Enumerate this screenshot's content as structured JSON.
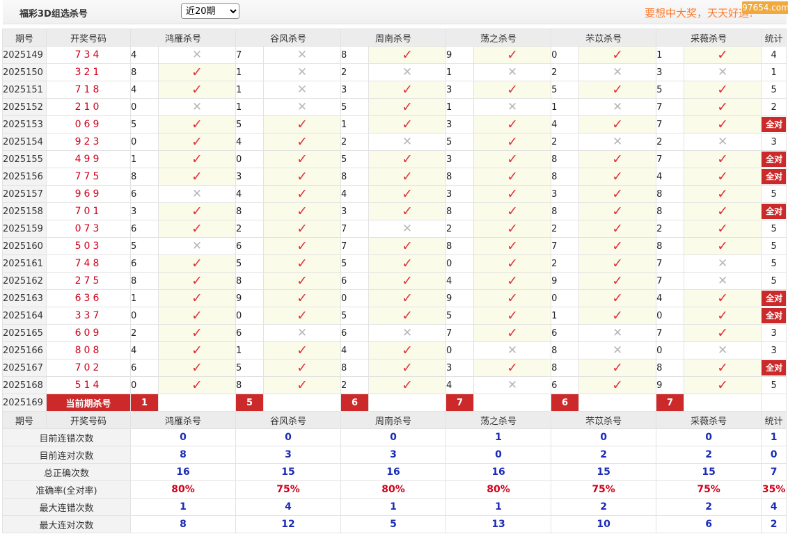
{
  "header": {
    "title": "福彩3D组选杀号",
    "period_selected": "近20期",
    "period_options": [
      "近20期"
    ],
    "slogan": "要想中大奖，天天",
    "slogan_tail": "好运!",
    "watermark": "97654.com"
  },
  "columns": {
    "issue": "期号",
    "draw": "开奖号码",
    "experts": [
      "鸿雁杀号",
      "谷风杀号",
      "周南杀号",
      "荡之杀号",
      "芣苡杀号",
      "采薇杀号"
    ],
    "stat": "统计"
  },
  "rows": [
    {
      "issue": "2025149",
      "draw": "734",
      "kills": [
        [
          "4",
          0
        ],
        [
          "7",
          0
        ],
        [
          "8",
          1
        ],
        [
          "9",
          1
        ],
        [
          "0",
          1
        ],
        [
          "1",
          1
        ]
      ],
      "stat": "4"
    },
    {
      "issue": "2025150",
      "draw": "321",
      "kills": [
        [
          "8",
          1
        ],
        [
          "1",
          0
        ],
        [
          "2",
          0
        ],
        [
          "1",
          0
        ],
        [
          "2",
          0
        ],
        [
          "3",
          0
        ]
      ],
      "stat": "1"
    },
    {
      "issue": "2025151",
      "draw": "718",
      "kills": [
        [
          "4",
          1
        ],
        [
          "1",
          0
        ],
        [
          "3",
          1
        ],
        [
          "3",
          1
        ],
        [
          "5",
          1
        ],
        [
          "5",
          1
        ]
      ],
      "stat": "5"
    },
    {
      "issue": "2025152",
      "draw": "210",
      "kills": [
        [
          "0",
          0
        ],
        [
          "1",
          0
        ],
        [
          "5",
          1
        ],
        [
          "1",
          0
        ],
        [
          "1",
          0
        ],
        [
          "7",
          1
        ]
      ],
      "stat": "2"
    },
    {
      "issue": "2025153",
      "draw": "069",
      "kills": [
        [
          "5",
          1
        ],
        [
          "5",
          1
        ],
        [
          "1",
          1
        ],
        [
          "3",
          1
        ],
        [
          "4",
          1
        ],
        [
          "7",
          1
        ]
      ],
      "stat": "全对"
    },
    {
      "issue": "2025154",
      "draw": "923",
      "kills": [
        [
          "0",
          1
        ],
        [
          "4",
          1
        ],
        [
          "2",
          0
        ],
        [
          "5",
          1
        ],
        [
          "2",
          0
        ],
        [
          "2",
          0
        ]
      ],
      "stat": "3"
    },
    {
      "issue": "2025155",
      "draw": "499",
      "kills": [
        [
          "1",
          1
        ],
        [
          "0",
          1
        ],
        [
          "5",
          1
        ],
        [
          "3",
          1
        ],
        [
          "8",
          1
        ],
        [
          "7",
          1
        ]
      ],
      "stat": "全对"
    },
    {
      "issue": "2025156",
      "draw": "775",
      "kills": [
        [
          "8",
          1
        ],
        [
          "3",
          1
        ],
        [
          "8",
          1
        ],
        [
          "8",
          1
        ],
        [
          "8",
          1
        ],
        [
          "4",
          1
        ]
      ],
      "stat": "全对"
    },
    {
      "issue": "2025157",
      "draw": "969",
      "kills": [
        [
          "6",
          0
        ],
        [
          "4",
          1
        ],
        [
          "4",
          1
        ],
        [
          "3",
          1
        ],
        [
          "3",
          1
        ],
        [
          "8",
          1
        ]
      ],
      "stat": "5"
    },
    {
      "issue": "2025158",
      "draw": "701",
      "kills": [
        [
          "3",
          1
        ],
        [
          "8",
          1
        ],
        [
          "3",
          1
        ],
        [
          "8",
          1
        ],
        [
          "8",
          1
        ],
        [
          "8",
          1
        ]
      ],
      "stat": "全对"
    },
    {
      "issue": "2025159",
      "draw": "073",
      "kills": [
        [
          "6",
          1
        ],
        [
          "2",
          1
        ],
        [
          "7",
          0
        ],
        [
          "2",
          1
        ],
        [
          "2",
          1
        ],
        [
          "2",
          1
        ]
      ],
      "stat": "5"
    },
    {
      "issue": "2025160",
      "draw": "503",
      "kills": [
        [
          "5",
          0
        ],
        [
          "6",
          1
        ],
        [
          "7",
          1
        ],
        [
          "8",
          1
        ],
        [
          "7",
          1
        ],
        [
          "8",
          1
        ]
      ],
      "stat": "5"
    },
    {
      "issue": "2025161",
      "draw": "748",
      "kills": [
        [
          "6",
          1
        ],
        [
          "5",
          1
        ],
        [
          "5",
          1
        ],
        [
          "0",
          1
        ],
        [
          "2",
          1
        ],
        [
          "7",
          0
        ]
      ],
      "stat": "5"
    },
    {
      "issue": "2025162",
      "draw": "275",
      "kills": [
        [
          "8",
          1
        ],
        [
          "8",
          1
        ],
        [
          "6",
          1
        ],
        [
          "4",
          1
        ],
        [
          "9",
          1
        ],
        [
          "7",
          0
        ]
      ],
      "stat": "5"
    },
    {
      "issue": "2025163",
      "draw": "636",
      "kills": [
        [
          "1",
          1
        ],
        [
          "9",
          1
        ],
        [
          "0",
          1
        ],
        [
          "9",
          1
        ],
        [
          "0",
          1
        ],
        [
          "4",
          1
        ]
      ],
      "stat": "全对"
    },
    {
      "issue": "2025164",
      "draw": "337",
      "kills": [
        [
          "0",
          1
        ],
        [
          "0",
          1
        ],
        [
          "5",
          1
        ],
        [
          "5",
          1
        ],
        [
          "1",
          1
        ],
        [
          "0",
          1
        ]
      ],
      "stat": "全对"
    },
    {
      "issue": "2025165",
      "draw": "609",
      "kills": [
        [
          "2",
          1
        ],
        [
          "6",
          0
        ],
        [
          "6",
          0
        ],
        [
          "7",
          1
        ],
        [
          "6",
          0
        ],
        [
          "7",
          1
        ]
      ],
      "stat": "3"
    },
    {
      "issue": "2025166",
      "draw": "808",
      "kills": [
        [
          "4",
          1
        ],
        [
          "1",
          1
        ],
        [
          "4",
          1
        ],
        [
          "0",
          0
        ],
        [
          "8",
          0
        ],
        [
          "0",
          0
        ]
      ],
      "stat": "3"
    },
    {
      "issue": "2025167",
      "draw": "702",
      "kills": [
        [
          "6",
          1
        ],
        [
          "5",
          1
        ],
        [
          "8",
          1
        ],
        [
          "3",
          1
        ],
        [
          "8",
          1
        ],
        [
          "8",
          1
        ]
      ],
      "stat": "全对"
    },
    {
      "issue": "2025168",
      "draw": "514",
      "kills": [
        [
          "0",
          1
        ],
        [
          "8",
          1
        ],
        [
          "2",
          1
        ],
        [
          "4",
          0
        ],
        [
          "6",
          1
        ],
        [
          "9",
          1
        ]
      ],
      "stat": "5"
    }
  ],
  "current": {
    "issue": "2025169",
    "label": "当前期杀号",
    "kills": [
      "1",
      "5",
      "6",
      "7",
      "6",
      "7"
    ]
  },
  "summary": {
    "rows": [
      {
        "label": "目前连错次数",
        "values": [
          "0",
          "0",
          "0",
          "1",
          "0",
          "0"
        ],
        "stat": "1"
      },
      {
        "label": "目前连对次数",
        "values": [
          "8",
          "3",
          "3",
          "0",
          "2",
          "2"
        ],
        "stat": "0"
      },
      {
        "label": "总正确次数",
        "values": [
          "16",
          "15",
          "16",
          "16",
          "15",
          "15"
        ],
        "stat": "7"
      },
      {
        "label": "准确率(全对率)",
        "values": [
          "80%",
          "75%",
          "80%",
          "80%",
          "75%",
          "75%"
        ],
        "stat": "35%",
        "highlight": true
      },
      {
        "label": "最大连错次数",
        "values": [
          "1",
          "4",
          "1",
          "1",
          "2",
          "2"
        ],
        "stat": "4"
      },
      {
        "label": "最大连对次数",
        "values": [
          "8",
          "12",
          "5",
          "13",
          "10",
          "6"
        ],
        "stat": "2"
      }
    ]
  },
  "icons": {
    "correct": "check-icon",
    "wrong": "cross-icon"
  },
  "colors": {
    "accent_red": "#cc2a2a",
    "draw_red": "#d0021b",
    "stat_blue": "#1a2bb8",
    "slogan_orange": "#ff7a2a"
  }
}
